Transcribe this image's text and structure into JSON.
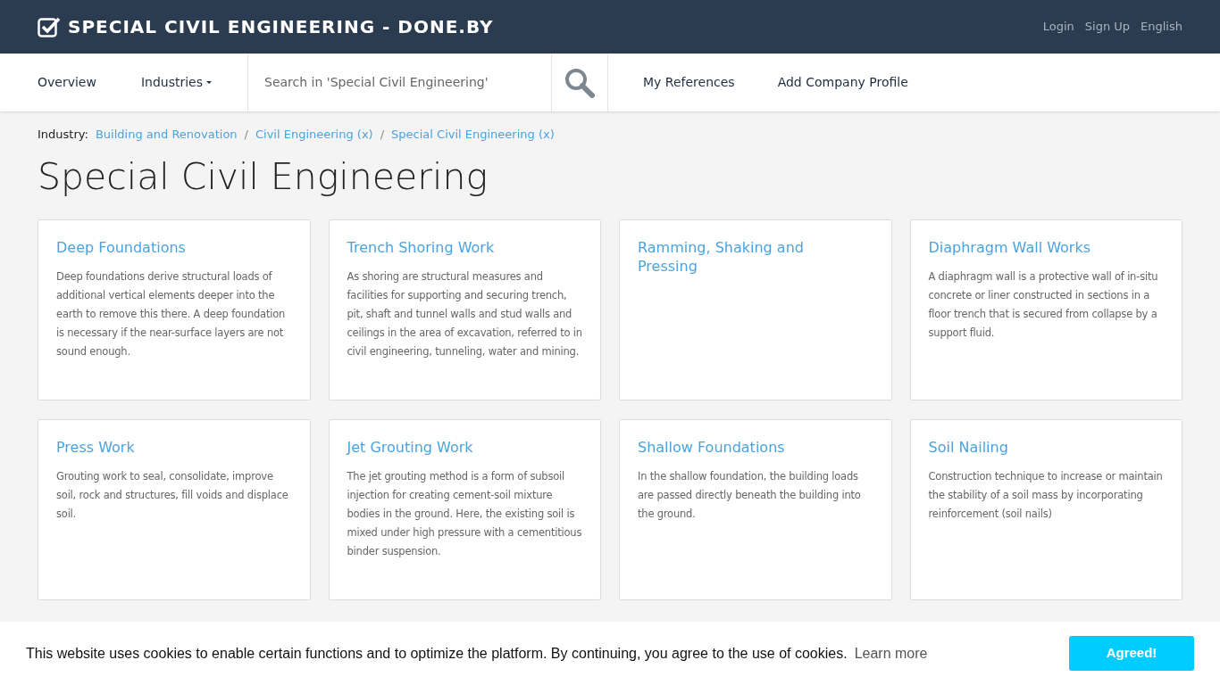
{
  "header": {
    "logo_text": "SPECIAL CIVIL ENGINEERING - DONE.BY",
    "links": [
      "Login",
      "Sign Up",
      "English"
    ]
  },
  "nav": {
    "items": [
      {
        "label": "Overview",
        "kind": "link"
      },
      {
        "label": "Industries",
        "kind": "dropdown"
      }
    ],
    "search": {
      "placeholder": "Search in 'Special Civil Engineering'"
    },
    "actions": [
      "My References",
      "Add Company Profile"
    ]
  },
  "breadcrumb": {
    "label": "Industry:",
    "separator": "/",
    "items": [
      "Building and Renovation",
      "Civil Engineering (x)",
      "Special Civil Engineering (x)"
    ]
  },
  "title": "Special Civil Engineering",
  "cards": [
    {
      "title": "Deep Foundations",
      "text": "Deep foundations derive structural loads of additional vertical elements deeper into the earth to remove this there. A deep foundation is necessary if the near-surface layers are not sound enough."
    },
    {
      "title": "Trench Shoring Work",
      "text": "As shoring are structural measures and facilities for supporting and securing trench, pit, shaft and tunnel walls and stud walls and ceilings in the area of excavation, referred to in civil engineering, tunneling, water and mining."
    },
    {
      "title": "Ramming, Shaking and Pressing"
    },
    {
      "title": "Diaphragm Wall Works",
      "text": "A diaphragm wall is a protective wall of in-situ concrete or liner constructed in sections in a floor trench that is secured from collapse by a support fluid."
    },
    {
      "title": "Press Work",
      "text": "Grouting work to seal, consolidate, improve soil, rock and structures, fill voids and displace soil."
    },
    {
      "title": "Jet Grouting Work",
      "text": "The jet grouting method is a form of subsoil injection for creating cement-soil mixture bodies in the ground. Here, the existing soil is mixed under high pressure with a cementitious binder suspension."
    },
    {
      "title": "Shallow Foundations",
      "text": "In the shallow foundation, the building loads are passed directly beneath the building into the ground."
    },
    {
      "title": "Soil Nailing",
      "text": "Construction technique to increase or maintain the stability of a soil mass by incorporating reinforcement (soil nails)"
    }
  ],
  "cookie_bar": {
    "text": "This website uses cookies to enable certain functions and to optimize the platform. By continuing, you agree to the use of cookies.",
    "link": "Learn more",
    "button": "Agreed!"
  }
}
